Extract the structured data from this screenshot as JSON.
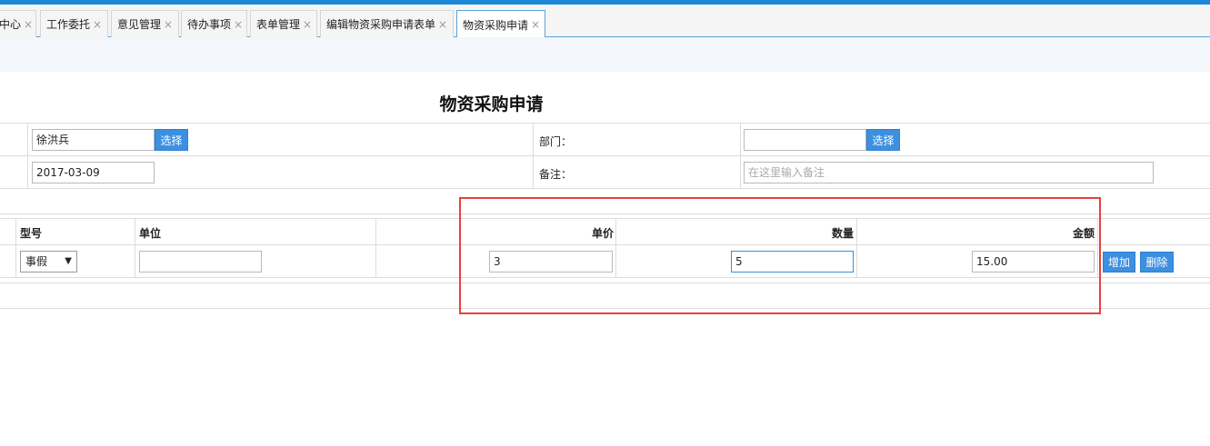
{
  "tabs": [
    {
      "label": "中心",
      "close": "×"
    },
    {
      "label": "工作委托",
      "close": "×"
    },
    {
      "label": "意见管理",
      "close": "×"
    },
    {
      "label": "待办事项",
      "close": "×"
    },
    {
      "label": "表单管理",
      "close": "×"
    },
    {
      "label": "编辑物资采购申请表单",
      "close": "×"
    },
    {
      "label": "物资采购申请",
      "close": "×"
    }
  ],
  "form": {
    "title": "物资采购申请",
    "applicant_value": "徐洪兵",
    "select_label": "选择",
    "department_label": "部门：",
    "department_value": "",
    "dept_select_label": "选择",
    "date_value": "2017-03-09",
    "remark_label": "备注：",
    "remark_placeholder": "在这里输入备注"
  },
  "table": {
    "headers": {
      "model": "型号",
      "unit": "单位",
      "price": "单价",
      "qty": "数量",
      "amount": "金额"
    },
    "row": {
      "model": "事假",
      "unit": "",
      "price": "3",
      "qty": "5",
      "amount": "15.00",
      "add_label": "增加",
      "delete_label": "删除"
    }
  }
}
